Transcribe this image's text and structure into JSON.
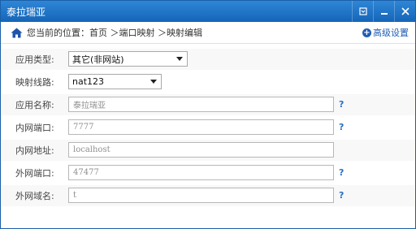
{
  "window": {
    "title": "泰拉瑞亚"
  },
  "controls": [
    {
      "name": "menu-icon"
    },
    {
      "name": "minimize-icon"
    },
    {
      "name": "close-icon"
    }
  ],
  "breadcrumb": {
    "prefix": "您当前的位置：",
    "path": "首页 ＞端口映射 ＞映射编辑"
  },
  "advanced": {
    "label": "高级设置"
  },
  "form": {
    "app_type": {
      "label": "应用类型:",
      "value": "其它(非网站)"
    },
    "route": {
      "label": "映射线路:",
      "value": "nat123"
    },
    "app_name": {
      "label": "应用名称:",
      "value": "泰拉瑞亚"
    },
    "lan_port": {
      "label": "内网端口:",
      "value": "7777"
    },
    "lan_addr": {
      "label": "内网地址:",
      "value": "localhost"
    },
    "wan_port": {
      "label": "外网端口:",
      "value": "47477"
    },
    "wan_domain": {
      "label": "外网域名:",
      "value": "t"
    }
  },
  "help_icon": "?"
}
